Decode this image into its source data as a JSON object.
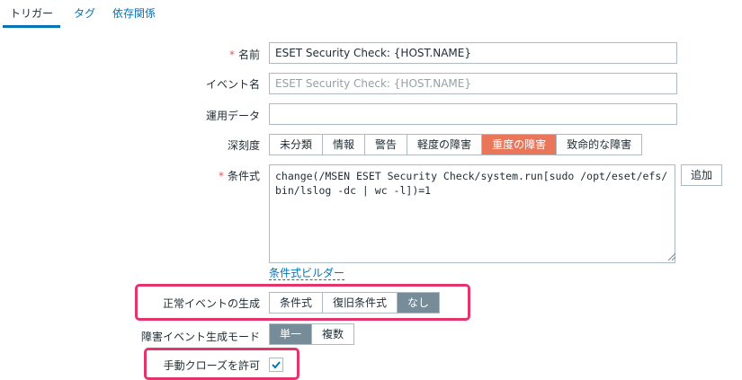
{
  "tabs": [
    {
      "label": "トリガー"
    },
    {
      "label": "タグ"
    },
    {
      "label": "依存関係"
    }
  ],
  "form": {
    "name": {
      "label": "名前",
      "value": "ESET Security Check: {HOST.NAME}"
    },
    "event_name": {
      "label": "イベント名",
      "placeholder": "ESET Security Check: {HOST.NAME}"
    },
    "opdata": {
      "label": "運用データ",
      "value": ""
    },
    "severity": {
      "label": "深刻度",
      "options": [
        "未分類",
        "情報",
        "警告",
        "軽度の障害",
        "重度の障害",
        "致命的な障害"
      ],
      "selected": "重度の障害"
    },
    "expression": {
      "label": "条件式",
      "value": "change(/MSEN ESET Security Check/system.run[sudo /opt/eset/efs/bin/lslog -dc | wc -l])=1",
      "add_button": "追加",
      "builder_link": "条件式ビルダー"
    },
    "ok_event": {
      "label": "正常イベントの生成",
      "options": [
        "条件式",
        "復旧条件式",
        "なし"
      ],
      "selected": "なし"
    },
    "problem_mode": {
      "label": "障害イベント生成モード",
      "options": [
        "単一",
        "複数"
      ],
      "selected": "単一"
    },
    "manual_close": {
      "label": "手動クローズを許可",
      "checked": true
    }
  },
  "colors": {
    "link": "#0275b8",
    "severity_high": "#e97659",
    "segment_selected": "#768d99",
    "highlight": "#e5336b",
    "required": "#e45959"
  }
}
